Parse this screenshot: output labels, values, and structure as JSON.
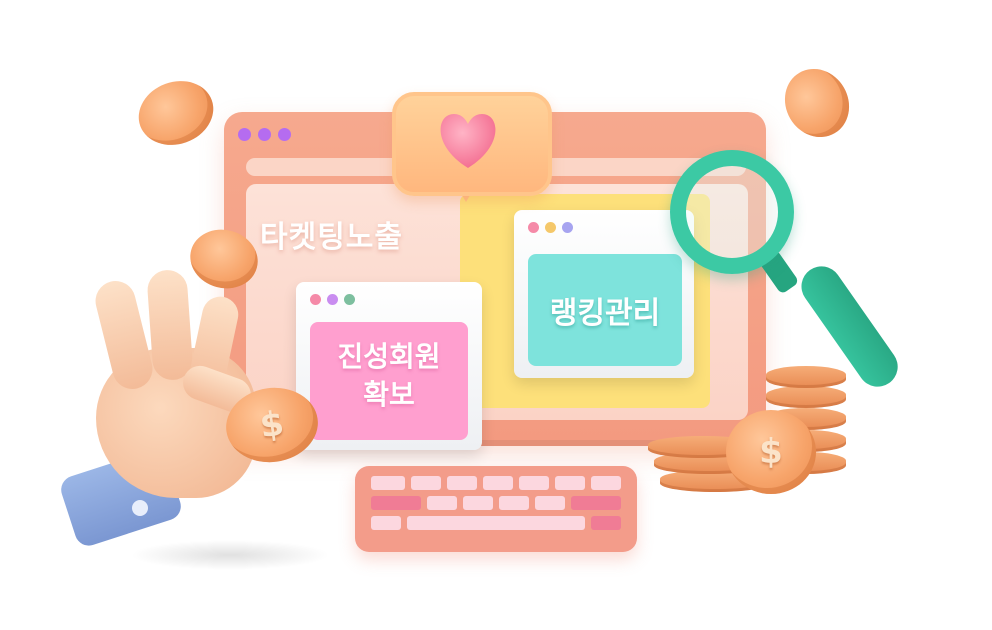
{
  "headline": "타켓팅노출",
  "panels": {
    "ranking": "랭킹관리",
    "members_line1": "진성회원",
    "members_line2": "확보"
  },
  "icons": {
    "heart": "heart-icon",
    "magnifier": "magnifier-icon",
    "dollar": "$"
  },
  "colors": {
    "monitor": "#f6a98e",
    "teal_panel": "#7ee3dc",
    "pink_panel": "#ff9fcf",
    "yellow_card": "#fde07a",
    "magnifier": "#3cc9a4"
  }
}
